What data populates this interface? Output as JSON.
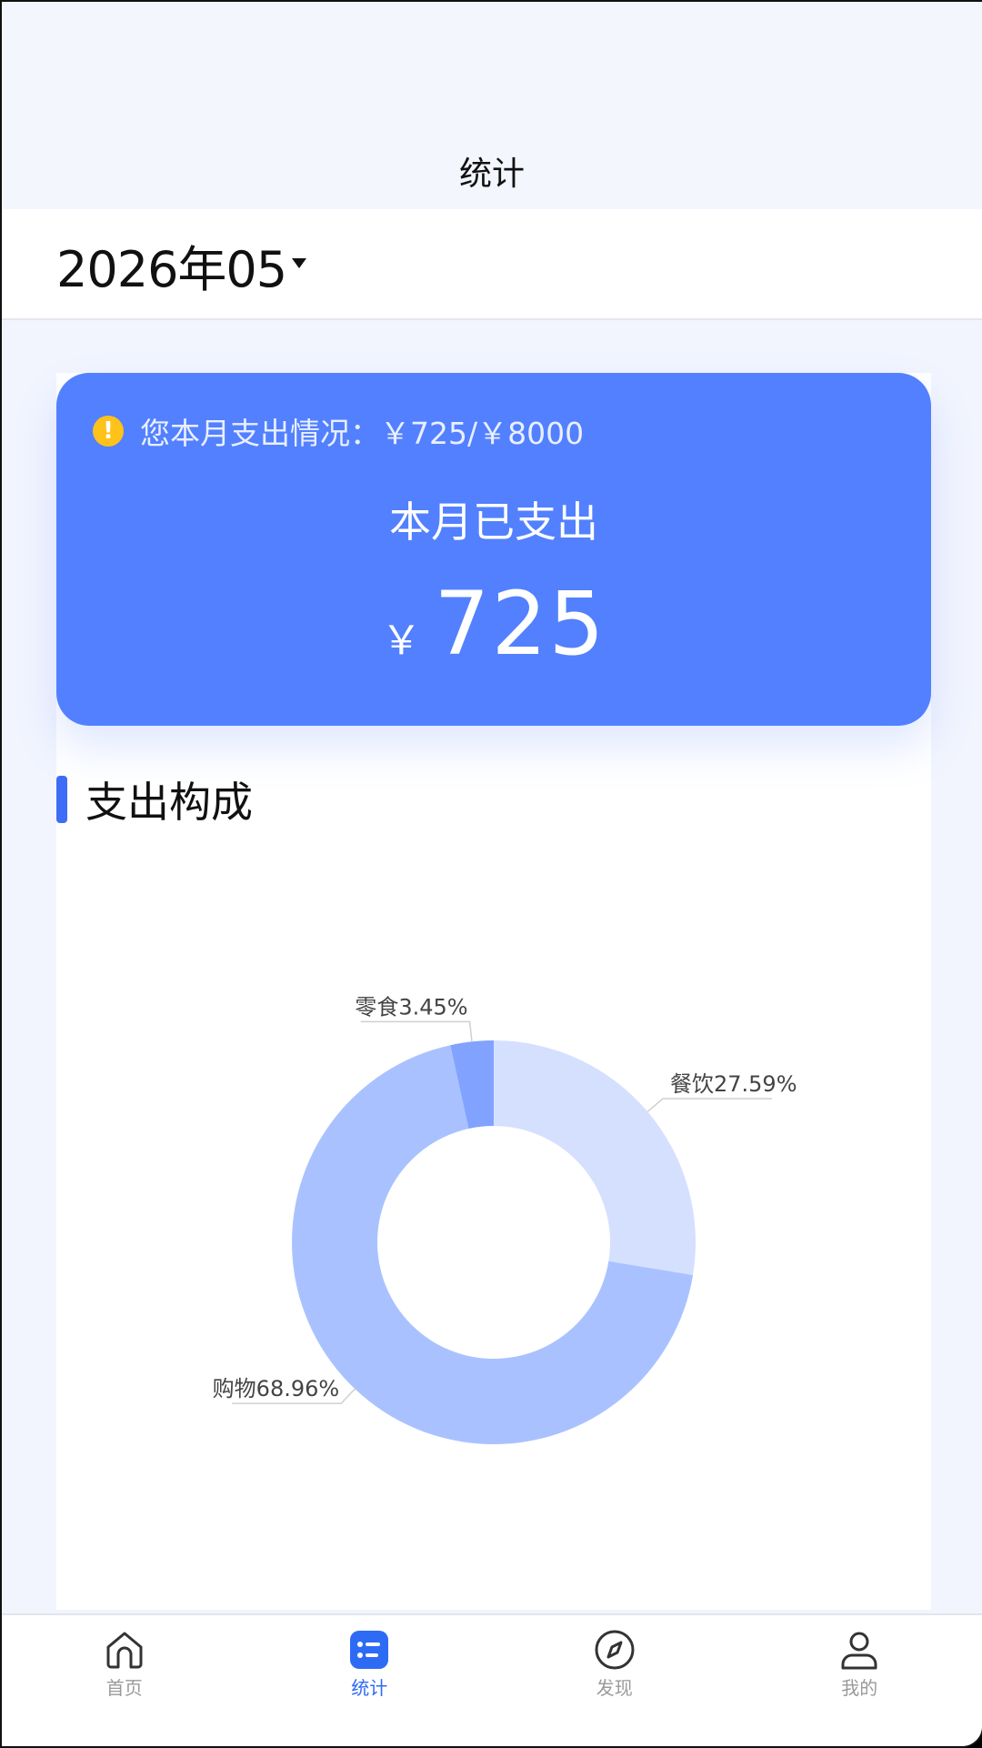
{
  "header": {
    "title": "统计"
  },
  "month_picker": {
    "value": "2026年05"
  },
  "summary": {
    "notice": "您本月支出情况：￥725/￥8000",
    "spent_label": "本月已支出",
    "currency": "￥",
    "amount": "725"
  },
  "section": {
    "title": "支出构成"
  },
  "chart_data": {
    "type": "pie",
    "donut": true,
    "slices": [
      {
        "name": "餐饮",
        "value": 27.59,
        "label": "餐饮27.59%",
        "color": "#d5e0ff"
      },
      {
        "name": "购物",
        "value": 68.96,
        "label": "购物68.96%",
        "color": "#a9c2ff"
      },
      {
        "name": "零食",
        "value": 3.45,
        "label": "零食3.45%",
        "color": "#81a3ff"
      }
    ]
  },
  "tabbar": {
    "items": [
      {
        "label": "首页",
        "icon": "home-icon",
        "active": false
      },
      {
        "label": "统计",
        "icon": "stats-list-icon",
        "active": true
      },
      {
        "label": "发现",
        "icon": "compass-icon",
        "active": false
      },
      {
        "label": "我的",
        "icon": "user-icon",
        "active": false
      }
    ]
  },
  "colors": {
    "accent": "#5280ff",
    "active_tab": "#2e6bf5",
    "warning": "#ffc21a"
  }
}
